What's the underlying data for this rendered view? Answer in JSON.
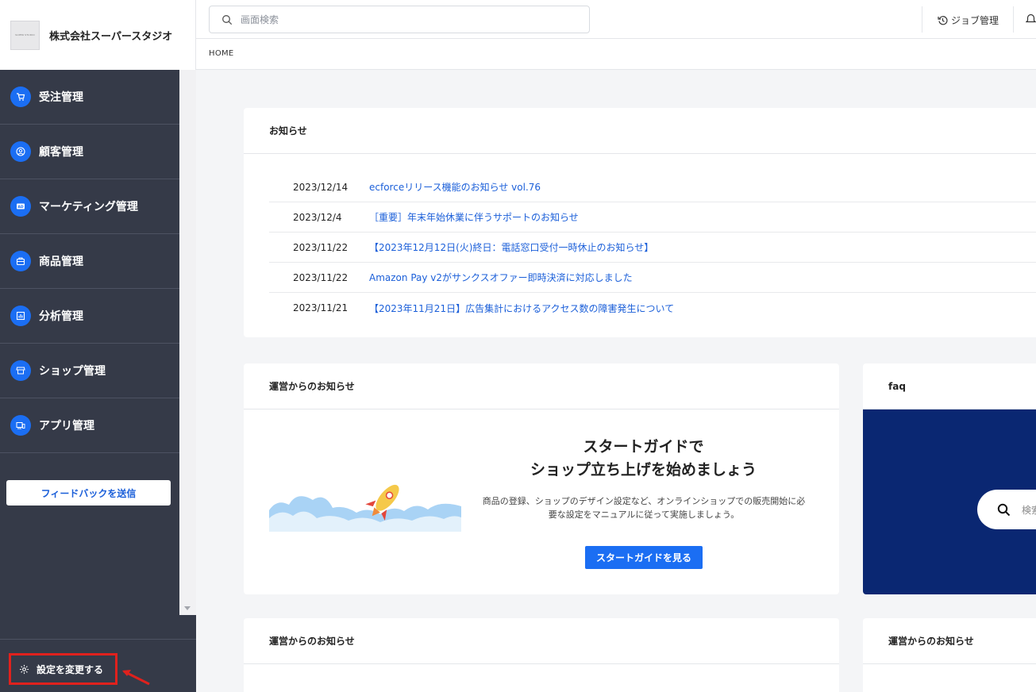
{
  "brand": {
    "logo_text": "SUPER STUDIO",
    "name": "株式会社スーパースタジオ"
  },
  "nav": {
    "items": [
      {
        "label": "受注管理",
        "icon": "cart-icon"
      },
      {
        "label": "顧客管理",
        "icon": "user-circle-icon"
      },
      {
        "label": "マーケティング管理",
        "icon": "ad-icon"
      },
      {
        "label": "商品管理",
        "icon": "box-icon"
      },
      {
        "label": "分析管理",
        "icon": "chart-icon"
      },
      {
        "label": "ショップ管理",
        "icon": "store-icon"
      },
      {
        "label": "アプリ管理",
        "icon": "devices-icon"
      }
    ],
    "feedback_label": "フィードバックを送信",
    "settings_label": "設定を変更する"
  },
  "header": {
    "search_placeholder": "画面検索",
    "job_label": "ジョブ管理"
  },
  "breadcrumb": "HOME",
  "news": {
    "title": "お知らせ",
    "items": [
      {
        "date": "2023/12/14",
        "text": "ecforceリリース機能のお知らせ vol.76"
      },
      {
        "date": "2023/12/4",
        "text": "［重要］年末年始休業に伴うサポートのお知らせ"
      },
      {
        "date": "2023/11/22",
        "text": "【2023年12月12日(火)終日：電話窓口受付一時休止のお知らせ】"
      },
      {
        "date": "2023/11/22",
        "text": "Amazon Pay v2がサンクスオファー即時決済に対応しました"
      },
      {
        "date": "2023/11/21",
        "text": "【2023年11月21日】広告集計におけるアクセス数の障害発生について"
      }
    ]
  },
  "guide": {
    "title": "運営からのお知らせ",
    "heading_line1": "スタートガイドで",
    "heading_line2": "ショップ立ち上げを始めましょう",
    "desc_line1": "商品の登録、ショップのデザイン設定など、オンラインショップでの販売開始に必",
    "desc_line2": "要な設定をマニュアルに従って実施しましょう。",
    "button_label": "スタートガイドを見る"
  },
  "faq": {
    "title": "faq",
    "search_text": "検索"
  },
  "bottom_cards": {
    "left_title": "運営からのお知らせ",
    "right_title": "運営からのお知らせ"
  },
  "colors": {
    "sidebar_bg": "#353a48",
    "accent": "#1b6ef3",
    "link": "#1b5fd9",
    "faq_bg": "#0a2772",
    "highlight": "#e0211d"
  }
}
